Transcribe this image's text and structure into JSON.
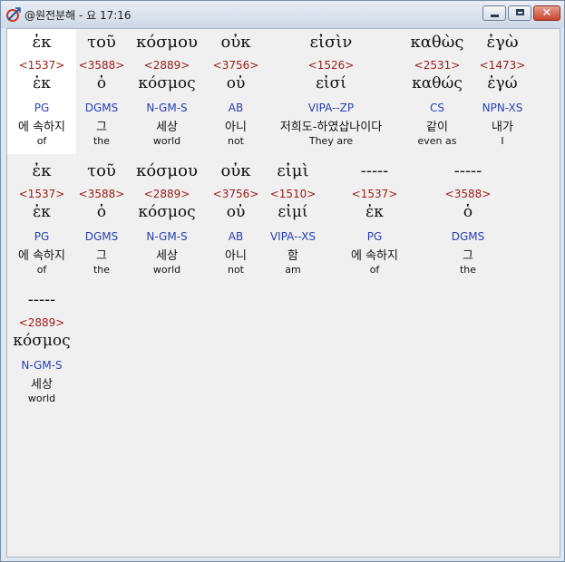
{
  "window": {
    "title": "@원전분해 - 요 17:16"
  },
  "rows": [
    [
      {
        "greek": "ἐκ",
        "strong": "<1537>",
        "lemma": "ἐκ",
        "parse": "PG",
        "korean": "에 속하지",
        "english": "of",
        "selected": true
      },
      {
        "greek": "τοῦ",
        "strong": "<3588>",
        "lemma": "ὁ",
        "parse": "DGMS",
        "korean": "그",
        "english": "the"
      },
      {
        "greek": "κόσμου",
        "strong": "<2889>",
        "lemma": "κόσμος",
        "parse": "N-GM-S",
        "korean": "세상",
        "english": "world"
      },
      {
        "greek": "οὐκ",
        "strong": "<3756>",
        "lemma": "οὐ",
        "parse": "AB",
        "korean": "아니",
        "english": "not"
      },
      {
        "greek": "εἰσὶν",
        "strong": "<1526>",
        "lemma": "εἰσί",
        "parse": "VIPA--ZP",
        "korean": "저희도-하였삽나이다",
        "english": "They are"
      },
      {
        "greek": "καθὼς",
        "strong": "<2531>",
        "lemma": "καθώς",
        "parse": "CS",
        "korean": "같이",
        "english": "even as"
      },
      {
        "greek": "ἐγὼ",
        "strong": "<1473>",
        "lemma": "ἐγώ",
        "parse": "NPN-XS",
        "korean": "내가",
        "english": "I"
      }
    ],
    [
      {
        "greek": "ἐκ",
        "strong": "<1537>",
        "lemma": "ἐκ",
        "parse": "PG",
        "korean": "에 속하지",
        "english": "of"
      },
      {
        "greek": "τοῦ",
        "strong": "<3588>",
        "lemma": "ὁ",
        "parse": "DGMS",
        "korean": "그",
        "english": "the"
      },
      {
        "greek": "κόσμου",
        "strong": "<2889>",
        "lemma": "κόσμος",
        "parse": "N-GM-S",
        "korean": "세상",
        "english": "world"
      },
      {
        "greek": "οὐκ",
        "strong": "<3756>",
        "lemma": "οὐ",
        "parse": "AB",
        "korean": "아니",
        "english": "not"
      },
      {
        "greek": "εἰμὶ",
        "strong": "<1510>",
        "lemma": "εἰμί",
        "parse": "VIPA--XS",
        "korean": "함",
        "english": "am"
      },
      {
        "greek": "-----",
        "strong": "<1537>",
        "lemma": "ἐκ",
        "parse": "PG",
        "korean": "에 속하지",
        "english": "of"
      },
      {
        "greek": "-----",
        "strong": "<3588>",
        "lemma": "ὁ",
        "parse": "DGMS",
        "korean": "그",
        "english": "the"
      }
    ],
    [
      {
        "greek": "-----",
        "strong": "<2889>",
        "lemma": "κόσμος",
        "parse": "N-GM-S",
        "korean": "세상",
        "english": "world"
      }
    ]
  ]
}
